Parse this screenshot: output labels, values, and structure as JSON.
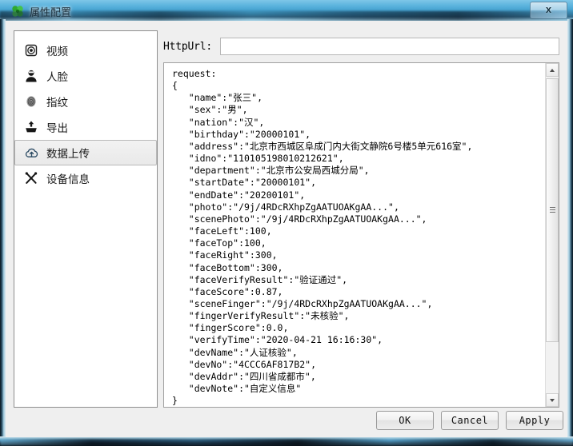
{
  "window": {
    "title": "属性配置",
    "title_icon": "clover-icon",
    "close_label": "x"
  },
  "sidebar": {
    "items": [
      {
        "label": "视频",
        "icon": "camera-icon",
        "selected": false
      },
      {
        "label": "人脸",
        "icon": "person-icon",
        "selected": false
      },
      {
        "label": "指纹",
        "icon": "fingerprint-icon",
        "selected": false
      },
      {
        "label": "导出",
        "icon": "export-icon",
        "selected": false
      },
      {
        "label": "数据上传",
        "icon": "cloud-upload-icon",
        "selected": true
      },
      {
        "label": "设备信息",
        "icon": "tools-icon",
        "selected": false
      }
    ]
  },
  "main": {
    "url_field": {
      "label": "HttpUrl:",
      "value": "",
      "placeholder": ""
    },
    "json_preview": "request:\n{\n   \"name\":\"张三\",\n   \"sex\":\"男\",\n   \"nation\":\"汉\",\n   \"birthday\":\"20000101\",\n   \"address\":\"北京市西城区阜成门内大街文静院6号楼5单元616室\",\n   \"idno\":\"110105198010212621\",\n   \"department\":\"北京市公安局西城分局\",\n   \"startDate\":\"20000101\",\n   \"endDate\":\"20200101\",\n   \"photo\":\"/9j/4RDcRXhpZgAATUOAKgAA...\",\n   \"scenePhoto\":\"/9j/4RDcRXhpZgAATUOAKgAA...\",\n   \"faceLeft\":100,\n   \"faceTop\":100,\n   \"faceRight\":300,\n   \"faceBottom\":300,\n   \"faceVerifyResult\":\"验证通过\",\n   \"faceScore\":0.87,\n   \"sceneFinger\":\"/9j/4RDcRXhpZgAATUOAKgAA...\",\n   \"fingerVerifyResult\":\"未核验\",\n   \"fingerScore\":0.0,\n   \"verifyTime\":\"2020-04-21 16:16:30\",\n   \"devName\":\"人证核验\",\n   \"devNo\":\"4CCC6AF817B2\",\n   \"devAddr\":\"四川省成都市\",\n   \"devNote\":\"自定义信息\"\n}\nresponse:\n{"
  },
  "footer": {
    "ok_label": "OK",
    "cancel_label": "Cancel",
    "apply_label": "Apply"
  },
  "colors": {
    "title_gradient_top": "#7fc6e8",
    "title_gradient_bottom": "#2a5f7d",
    "client_bg": "#efefef",
    "panel_bg": "#ffffff",
    "selected_item_bg": "#eeeeee",
    "cloud_icon": "#2b4a63"
  }
}
